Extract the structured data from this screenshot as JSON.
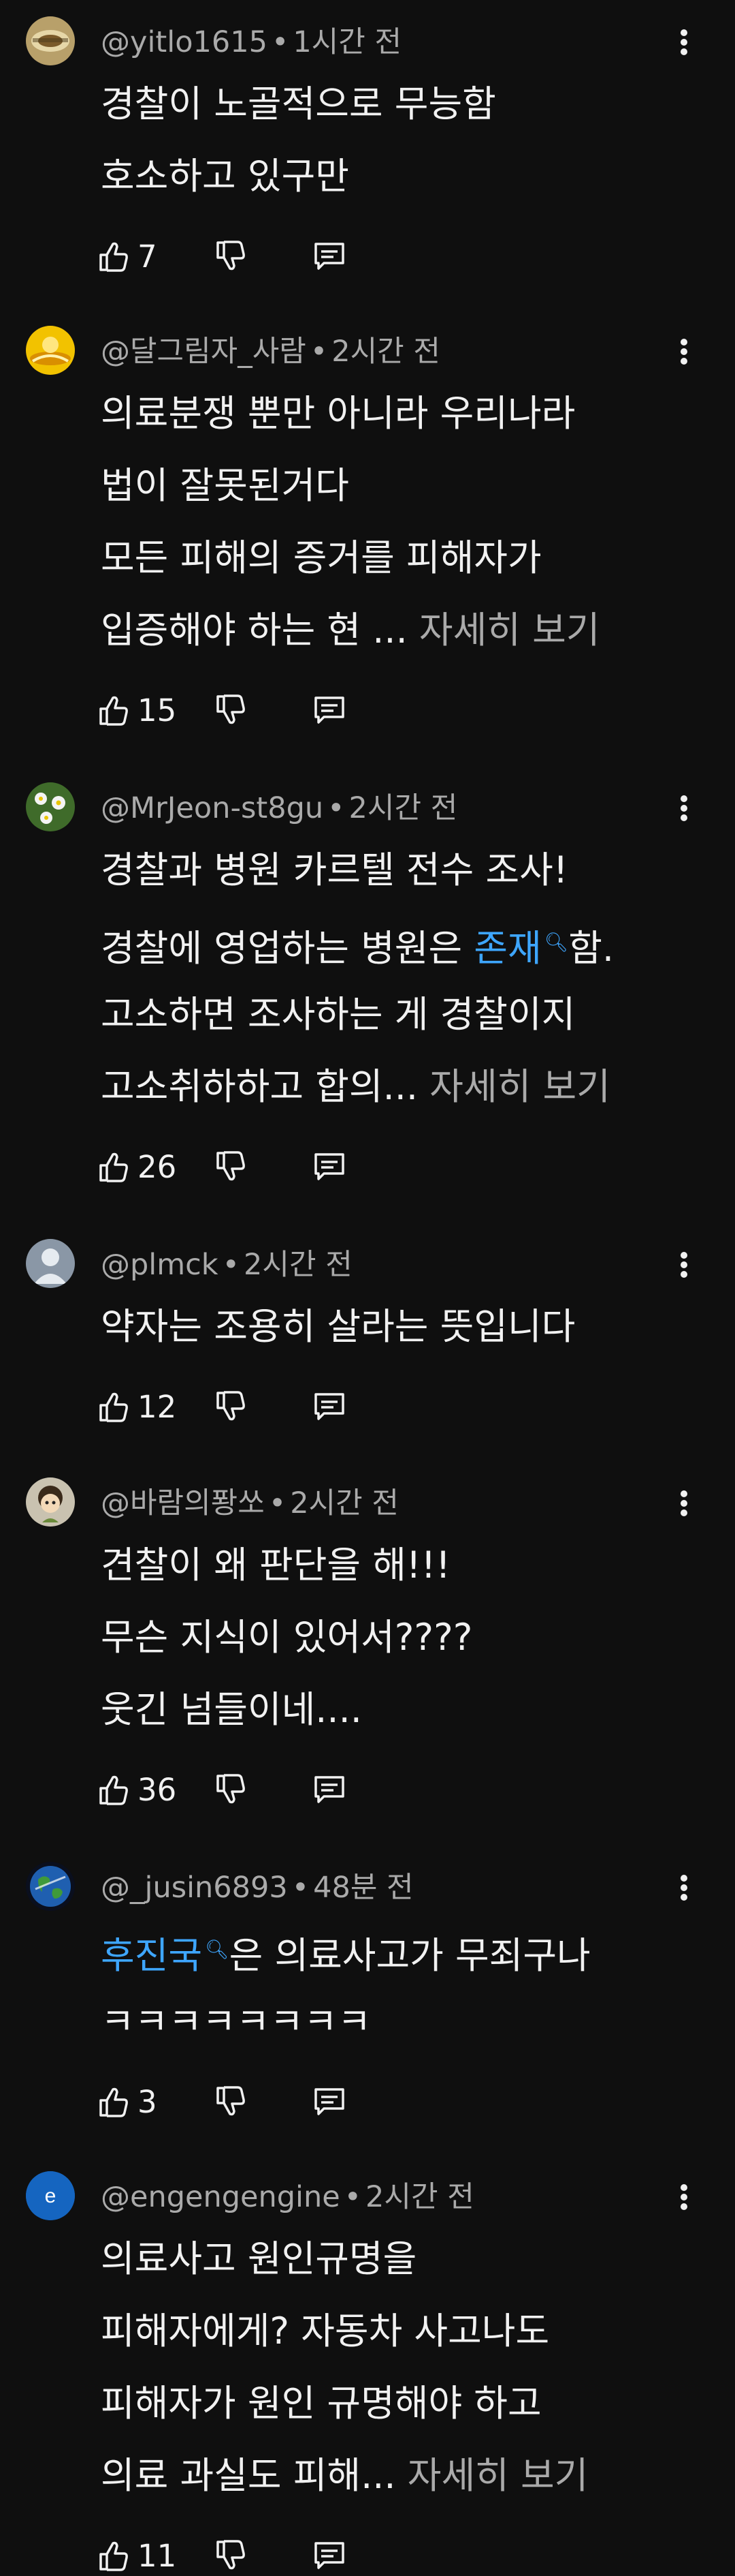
{
  "comments": [
    {
      "author": "@yitlo1615",
      "time": "1시간 전",
      "lines": [
        "경찰이 노골적으로 무능함",
        "호소하고 있구만"
      ],
      "likes": "7",
      "avatar": "photo-gold"
    },
    {
      "author": "@달그림자_사람",
      "time": "2시간 전",
      "lines": [
        "의료분쟁 뿐만 아니라 우리나라",
        "법이 잘못된거다",
        "모든 피해의 증거를 피해자가",
        "입증해야 하는 현 ..."
      ],
      "more": "자세히 보기",
      "likes": "15",
      "avatar": "photo-yellow"
    },
    {
      "author": "@MrJeon-st8gu",
      "time": "2시간 전",
      "line1": "경찰과 병원 카르텔 전수 조사!",
      "line2_pre": "경찰에 영업하는 병원은 ",
      "line2_link": "존재",
      "line2_post": "함.",
      "line3": "고소하면 조사하는 게 경찰이지",
      "line4": "고소취하하고 합의...",
      "more": "자세히 보기",
      "likes": "26",
      "avatar": "photo-flowers"
    },
    {
      "author": "@plmck",
      "time": "2시간 전",
      "lines": [
        "약자는 조용히 살라는 뜻입니다"
      ],
      "likes": "12",
      "avatar": "default-person"
    },
    {
      "author": "@바람의퐝쏘",
      "time": "2시간 전",
      "lines": [
        "견찰이 왜 판단을 해!!!",
        "무슨 지식이 있어서????",
        "웃긴 넘들이네...."
      ],
      "likes": "36",
      "avatar": "photo-character"
    },
    {
      "author": "@_jusin6893",
      "time": "48분 전",
      "line1_link": "후진국",
      "line1_post": "은 의료사고가 무죄구나",
      "line2": "ㅋㅋㅋㅋㅋㅋㅋㅋ",
      "likes": "3",
      "avatar": "photo-earth"
    },
    {
      "author": "@engengengine",
      "time": "2시간 전",
      "lines": [
        "의료사고 원인규명을",
        "피해자에게? 자동차 사고나도",
        "피해자가 원인 규명해야 하고",
        "의료 과실도 피해..."
      ],
      "more": "자세히 보기",
      "likes": "11",
      "avatar": "letter-avatar",
      "avatar_letter": "e"
    }
  ],
  "dot": "•",
  "search_link_icon": "search-link-icon",
  "colors": {
    "background": "#0f0f0f",
    "text": "#f1f1f1",
    "secondary": "#aaaaaa",
    "link": "#3ea6ff",
    "letter_avatar": "#1565c0"
  }
}
